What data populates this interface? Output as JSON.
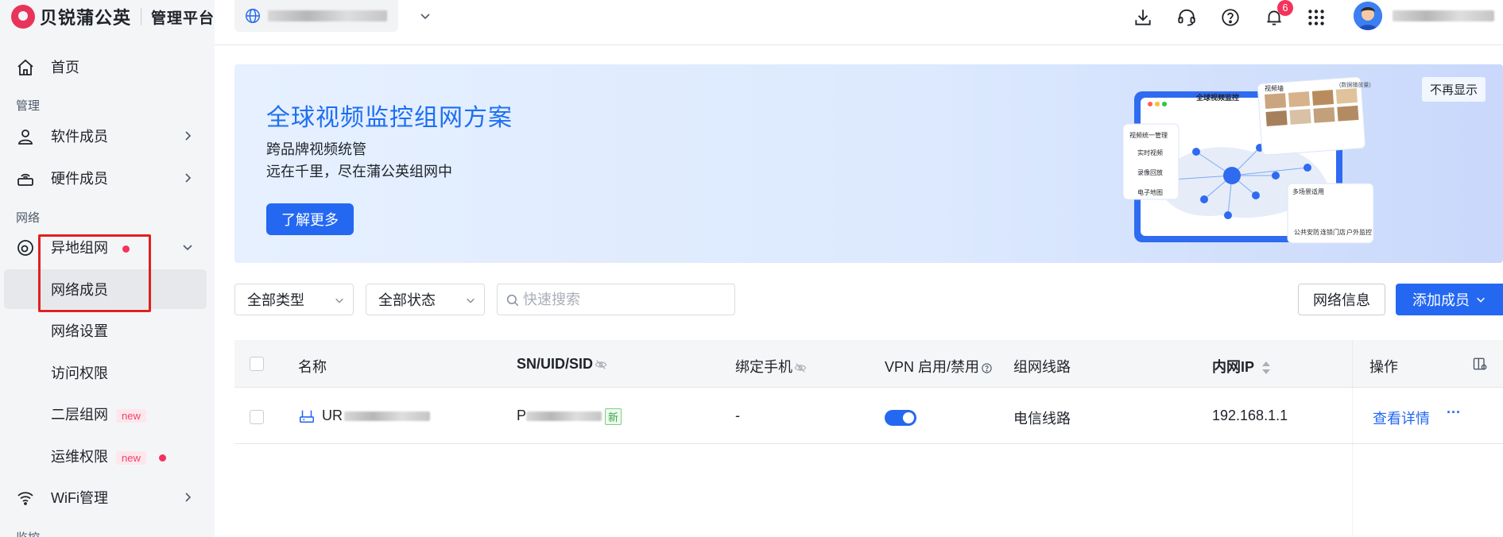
{
  "brand": {
    "name": "贝锐蒲公英",
    "subtitle": "管理平台"
  },
  "sidebar": {
    "home": "首页",
    "section_manage": "管理",
    "software_members": "软件成员",
    "hardware_members": "硬件成员",
    "section_network": "网络",
    "remote_network": "异地组网",
    "network_members": "网络成员",
    "network_settings": "网络设置",
    "access_rights": "访问权限",
    "layer2_network": "二层组网",
    "ops_rights": "运维权限",
    "new_tag": "new",
    "wifi": "WiFi管理",
    "section_monitor": "监控"
  },
  "topbar": {
    "notification_count": "6"
  },
  "banner": {
    "title": "全球视频监控组网方案",
    "sub1": "跨品牌视频统管",
    "sub2": "远在千里，尽在蒲公英组网中",
    "button": "了解更多",
    "dismiss": "不再显示",
    "illus_window_title": "全球视频监控",
    "illus_left_title": "视频统一管理",
    "illus_left_items": [
      "实时视频",
      "录像回放",
      "电子地图"
    ],
    "illus_top_title": "视频墙",
    "illus_top_tag": "(数据播放量)",
    "illus_bottom_title": "多场景适用",
    "illus_bottom_items": [
      "公共安防",
      "连锁门店",
      "户外监控"
    ]
  },
  "filters": {
    "type": "全部类型",
    "status": "全部状态",
    "search_placeholder": "快速搜索",
    "network_info": "网络信息",
    "add_member": "添加成员"
  },
  "table": {
    "headers": {
      "name": "名称",
      "sn": "SN/UID/SID",
      "phone": "绑定手机",
      "vpn": "VPN 启用/禁用",
      "line": "组网线路",
      "ip": "内网IP",
      "ops": "操作"
    },
    "rows": [
      {
        "name_prefix": "UR",
        "sn_prefix": "P",
        "sn_tag": "新",
        "phone": "-",
        "vpn_enabled": true,
        "line": "电信线路",
        "ip": "192.168.1.1",
        "action": "查看详情",
        "more": "···"
      }
    ]
  },
  "colors": {
    "primary": "#2468f2",
    "brand": "#e8335b",
    "highlight": "#e02020"
  }
}
